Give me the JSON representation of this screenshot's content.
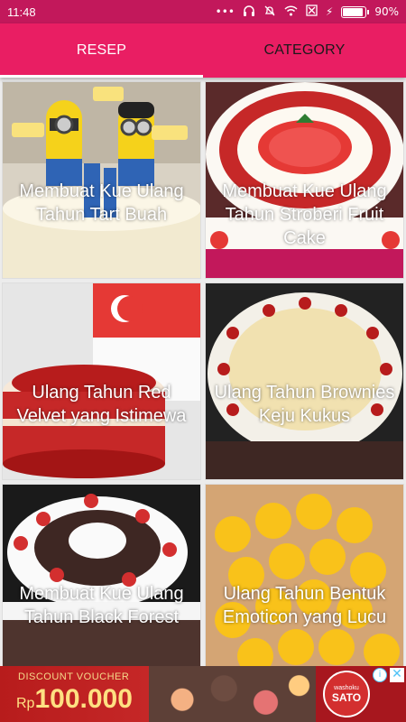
{
  "status": {
    "time": "11:48",
    "battery": "90%",
    "battery_level": 0.9,
    "icons": [
      "more-icon",
      "headset-icon",
      "mute-icon",
      "wifi-icon",
      "signal-off-icon",
      "charging-icon"
    ]
  },
  "tabs": [
    {
      "label": "RESEP",
      "active": true
    },
    {
      "label": "CATEGORY",
      "active": false
    }
  ],
  "recipes": [
    {
      "title": "Membuat Kue Ulang Tahun Tart Buah",
      "theme": "minion"
    },
    {
      "title": "Membuat Kue Ulang Tahun Stroberi Fruit Cake",
      "theme": "strawberry"
    },
    {
      "title": "Ulang Tahun Red Velvet yang Istimewa",
      "theme": "redvelvet"
    },
    {
      "title": "Ulang Tahun Brownies Keju Kukus",
      "theme": "brownies"
    },
    {
      "title": "Membuat Kue Ulang Tahun Black Forest",
      "theme": "blackforest"
    },
    {
      "title": "Ulang Tahun Bentuk Emoticon yang Lucu",
      "theme": "emoticon"
    }
  ],
  "ad": {
    "voucher_label": "DISCOUNT VOUCHER",
    "currency": "Rp",
    "amount": "100.000",
    "brand_small": "washoku",
    "brand_big": "SATO",
    "info_icon": "i",
    "close_icon": "✕"
  },
  "colors": {
    "status_bar": "#c2185b",
    "tab_bar": "#e91e63",
    "ad_background": "#a7171e"
  }
}
